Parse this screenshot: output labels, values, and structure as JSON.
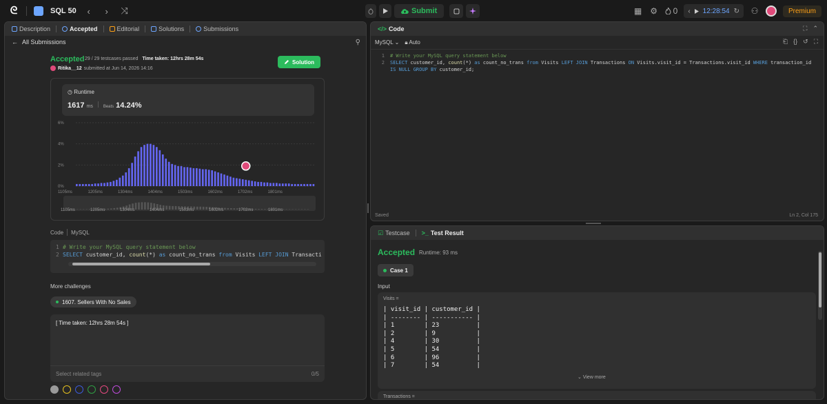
{
  "topbar": {
    "logo": "ᘓ",
    "problem_list_title": "SQL 50",
    "prev": "‹",
    "next": "›",
    "shuffle": "⤨",
    "submit_label": "Submit",
    "streak_count": "0",
    "timer": "12:28:54",
    "premium_label": "Premium"
  },
  "left_tabs": [
    {
      "label": "Description"
    },
    {
      "label": "Accepted"
    },
    {
      "label": "Editorial"
    },
    {
      "label": "Solutions"
    },
    {
      "label": "Submissions"
    }
  ],
  "submission": {
    "back_label": "All Submissions",
    "status": "Accepted",
    "testcases": "29 / 29 testcases passed",
    "time_taken": "Time taken: 12hrs 28m 54s",
    "user": "Ritika__12",
    "submitted_at": "submitted at Jun 14, 2026 14:16",
    "solution_button": "Solution"
  },
  "runtime": {
    "label": "Runtime",
    "value": "1617",
    "unit": "ms",
    "beats_label": "Beats",
    "beats_value": "14.24%"
  },
  "chart_data": {
    "type": "bar",
    "title": "",
    "xlabel": "",
    "ylabel": "",
    "ylim": [
      0,
      6
    ],
    "yticks": [
      "6%",
      "4%",
      "2%",
      "0%"
    ],
    "xticks": [
      "1105ms",
      "1205ms",
      "1304ms",
      "1404ms",
      "1503ms",
      "1602ms",
      "1702ms",
      "1801ms"
    ],
    "values": [
      0.2,
      0.2,
      0.2,
      0.2,
      0.2,
      0.2,
      0.25,
      0.25,
      0.3,
      0.3,
      0.35,
      0.4,
      0.5,
      0.6,
      0.8,
      1.0,
      1.3,
      1.7,
      2.2,
      2.8,
      3.3,
      3.7,
      3.9,
      4.0,
      4.0,
      3.9,
      3.7,
      3.4,
      3.0,
      2.6,
      2.3,
      2.1,
      2.0,
      1.9,
      1.9,
      1.8,
      1.8,
      1.75,
      1.7,
      1.7,
      1.65,
      1.6,
      1.6,
      1.55,
      1.5,
      1.4,
      1.3,
      1.2,
      1.1,
      1.0,
      0.9,
      0.8,
      0.75,
      0.7,
      0.65,
      0.6,
      0.55,
      0.5,
      0.45,
      0.4,
      0.4,
      0.35,
      0.35,
      0.3,
      0.3,
      0.3,
      0.25,
      0.25,
      0.25,
      0.25,
      0.2,
      0.2,
      0.2,
      0.2,
      0.2,
      0.2,
      0.2,
      0.2
    ],
    "highlight_index": 55,
    "bar_color": "#6466f1",
    "overview_xticks": [
      "1105ms",
      "1205ms",
      "1304ms",
      "1404ms",
      "1503ms",
      "1602ms",
      "1702ms",
      "1801ms"
    ]
  },
  "code": {
    "label": "Code",
    "lang": "MySQL",
    "line1": "# Write your MySQL query statement below",
    "line2_kw1": "SELECT",
    "line2_rest1": " customer_id, ",
    "line2_fn": "count",
    "line2_rest2": "(*) ",
    "line2_kw2": "as",
    "line2_rest3": " count_no_trans ",
    "line2_kw3": "from",
    "line2_rest4": " Visits ",
    "line2_kw4": "LEFT JOIN",
    "line2_rest5": " Transacti"
  },
  "more": {
    "title": "More challenges",
    "challenge": "1607. Sellers With No Sales"
  },
  "notes": {
    "text": "[ Time taken: 12hrs 28m 54s ]",
    "tags_placeholder": "Select related tags",
    "count": "0/5"
  },
  "color_dots": [
    "#9a9a9a",
    "#e5c01f",
    "#3b5bdb",
    "#2f9e44",
    "#e64980",
    "#be4bdb"
  ],
  "editor": {
    "title": "Code",
    "lang": "MySQL",
    "mode": "Auto",
    "line1": "# Write your MySQL query statement below",
    "l2a": "SELECT",
    "l2b": " customer_id, ",
    "l2c": "count",
    "l2d": "(*) ",
    "l2e": "as",
    "l2f": " count_no_trans ",
    "l2g": "from",
    "l2h": " Visits ",
    "l2i": "LEFT JOIN",
    "l2j": " Transactions ",
    "l2k": "ON",
    "l2l": " Visits.visit_id = Transactions.visit_id ",
    "l2m": "WHERE",
    "l2n": " transaction_id",
    "l3a": "IS NULL GROUP BY",
    "l3b": " customer_id;",
    "saved": "Saved",
    "position": "Ln 2, Col 175"
  },
  "test": {
    "tab1": "Testcase",
    "tab2": "Test Result",
    "status": "Accepted",
    "runtime": "Runtime: 93 ms",
    "case": "Case 1",
    "input_label": "Input",
    "visits_label": "Visits =",
    "table": "| visit_id | customer_id |\n| -------- | ----------- |\n| 1        | 23          |\n| 2        | 9           |\n| 4        | 30          |\n| 5        | 54          |\n| 6        | 96          |\n| 7        | 54          |",
    "view_more": "View more",
    "transactions_label": "Transactions ="
  }
}
